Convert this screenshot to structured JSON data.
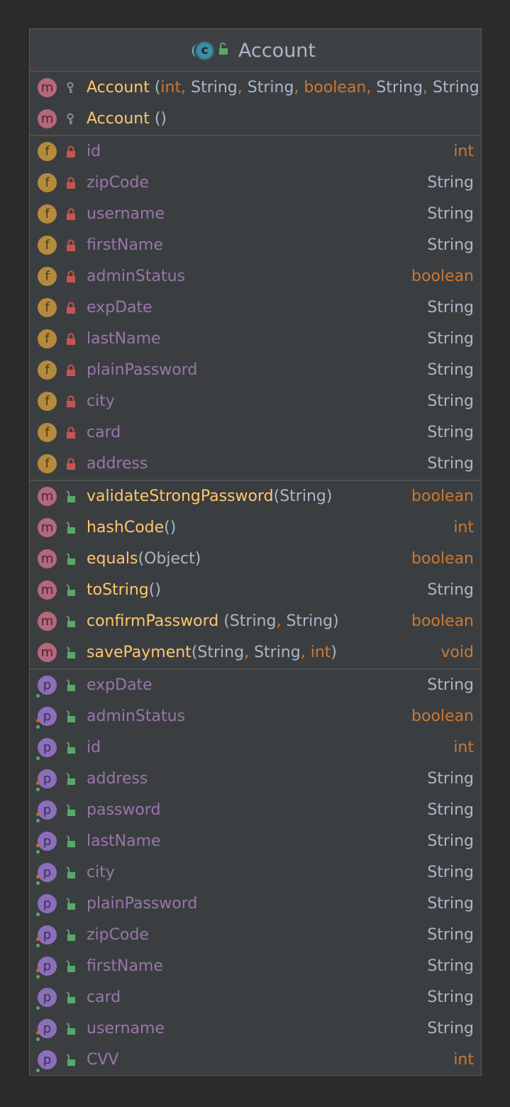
{
  "class_title": "Account",
  "icons": {
    "class": "class-icon",
    "constructor": "method-icon",
    "field": "field-icon",
    "property": "property-icon"
  },
  "colors": {
    "field_name": "#9876aa",
    "method_name": "#ffc66d",
    "keyword_type": "#cc7832",
    "plain_type": "#a9b7c6"
  },
  "constructors": [
    {
      "name": "Account",
      "params": [
        {
          "t": "int",
          "kw": true
        },
        {
          "t": "String",
          "kw": false
        },
        {
          "t": "String",
          "kw": false
        },
        {
          "t": "boolean",
          "kw": true
        },
        {
          "t": "String",
          "kw": false
        },
        {
          "t": "String",
          "kw": false
        },
        {
          "t": "Str",
          "kw": false
        }
      ]
    },
    {
      "name": "Account",
      "params": []
    }
  ],
  "fields": [
    {
      "name": "id",
      "type": "int",
      "kw": true
    },
    {
      "name": "zipCode",
      "type": "String",
      "kw": false
    },
    {
      "name": "username",
      "type": "String",
      "kw": false
    },
    {
      "name": "firstName",
      "type": "String",
      "kw": false
    },
    {
      "name": "adminStatus",
      "type": "boolean",
      "kw": true
    },
    {
      "name": "expDate",
      "type": "String",
      "kw": false
    },
    {
      "name": "lastName",
      "type": "String",
      "kw": false
    },
    {
      "name": "plainPassword",
      "type": "String",
      "kw": false
    },
    {
      "name": "city",
      "type": "String",
      "kw": false
    },
    {
      "name": "card",
      "type": "String",
      "kw": false
    },
    {
      "name": "address",
      "type": "String",
      "kw": false
    }
  ],
  "methods": [
    {
      "name": "validateStrongPassword",
      "gap": false,
      "params": [
        {
          "t": "String",
          "kw": false
        }
      ],
      "type": "boolean",
      "kw": true
    },
    {
      "name": "hashCode",
      "gap": false,
      "params": [],
      "type": "int",
      "kw": true
    },
    {
      "name": "equals",
      "gap": false,
      "params": [
        {
          "t": "Object",
          "kw": false
        }
      ],
      "type": "boolean",
      "kw": true
    },
    {
      "name": "toString",
      "gap": false,
      "params": [],
      "type": "String",
      "kw": false
    },
    {
      "name": "confirmPassword",
      "gap": true,
      "params": [
        {
          "t": "String",
          "kw": false
        },
        {
          "t": "String",
          "kw": false
        }
      ],
      "type": "boolean",
      "kw": true
    },
    {
      "name": "savePayment",
      "gap": false,
      "params": [
        {
          "t": "String",
          "kw": false
        },
        {
          "t": "String",
          "kw": false
        },
        {
          "t": "int",
          "kw": true
        }
      ],
      "type": "void",
      "kw": true
    }
  ],
  "properties": [
    {
      "name": "expDate",
      "type": "String",
      "kw": false,
      "setter": false
    },
    {
      "name": "adminStatus",
      "type": "boolean",
      "kw": true,
      "setter": true
    },
    {
      "name": "id",
      "type": "int",
      "kw": true,
      "setter": false
    },
    {
      "name": "address",
      "type": "String",
      "kw": false,
      "setter": true
    },
    {
      "name": "password",
      "type": "String",
      "kw": false,
      "setter": true
    },
    {
      "name": "lastName",
      "type": "String",
      "kw": false,
      "setter": true
    },
    {
      "name": "city",
      "type": "String",
      "kw": false,
      "setter": true
    },
    {
      "name": "plainPassword",
      "type": "String",
      "kw": false,
      "setter": false
    },
    {
      "name": "zipCode",
      "type": "String",
      "kw": false,
      "setter": true
    },
    {
      "name": "firstName",
      "type": "String",
      "kw": false,
      "setter": true
    },
    {
      "name": "card",
      "type": "String",
      "kw": false,
      "setter": false
    },
    {
      "name": "username",
      "type": "String",
      "kw": false,
      "setter": true
    },
    {
      "name": "CVV",
      "type": "int",
      "kw": true,
      "setter": false
    }
  ]
}
